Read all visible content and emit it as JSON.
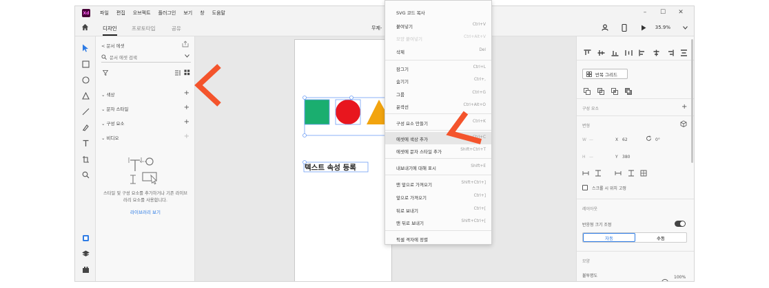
{
  "app": {
    "logo_text": "Xd",
    "menus": [
      "파일",
      "편집",
      "오브젝트",
      "플러그인",
      "보기",
      "창",
      "도움말"
    ],
    "window_controls": [
      "–",
      "☐",
      "✕"
    ]
  },
  "tabs": {
    "design": "디자인",
    "prototype": "프로토타입",
    "share": "공유"
  },
  "document": {
    "title": "무제-"
  },
  "zoom": "35.9%",
  "left_panel": {
    "back_label": "< 문서 에셋",
    "search_placeholder": "문서 에셋 검색",
    "sections": [
      {
        "label": "⌄ 색상",
        "add": "+"
      },
      {
        "label": "⌄ 문자 스타일",
        "add": "+"
      },
      {
        "label": "⌄ 구성 요소",
        "add": "+"
      },
      {
        "label": "⌄ 비디오",
        "add": "+"
      }
    ],
    "empty_text": "스타일 및 구성 요소를 추가하거나 기존 라이브러리 요소를 사용합니다.",
    "link": "라이브러리 보기"
  },
  "canvas": {
    "text_element": "텍스트 속성 등록",
    "colors": {
      "square": "#1aae6f",
      "circle": "#e8161e",
      "triangle": "#f2a40f",
      "selection": "#6e9ef5"
    }
  },
  "context_menu": {
    "items": [
      {
        "label": "SVG 코드 복사",
        "shortcut": ""
      },
      {
        "label": "붙여넣기",
        "shortcut": "Ctrl+V"
      },
      {
        "label": "모양 붙여넣기",
        "shortcut": "Ctrl+Alt+V"
      },
      {
        "label": "삭제",
        "shortcut": "Del"
      },
      {
        "label": "잠그기",
        "shortcut": "Ctrl+L"
      },
      {
        "label": "숨기기",
        "shortcut": "Ctrl+,"
      },
      {
        "label": "그룹",
        "shortcut": "Ctrl+G"
      },
      {
        "label": "윤곽선",
        "shortcut": "Ctrl+Alt+O"
      },
      {
        "label": "구성 요소 만들기",
        "shortcut": "Ctrl+K"
      },
      {
        "label": "에셋에 색상 추가",
        "shortcut": "Shift+Ctrl+C"
      },
      {
        "label": "에셋에 문자 스타일 추가",
        "shortcut": "Shift+Ctrl+T"
      },
      {
        "label": "내보내기에 대해 표시",
        "shortcut": "Shift+E"
      },
      {
        "label": "맨 앞으로 가져오기",
        "shortcut": "Shift+Ctrl+]"
      },
      {
        "label": "앞으로 가져오기",
        "shortcut": "Ctrl+]"
      },
      {
        "label": "뒤로 보내기",
        "shortcut": "Ctrl+["
      },
      {
        "label": "맨 뒤로 보내기",
        "shortcut": "Shift+Ctrl+["
      },
      {
        "label": "픽셀 격자에 정렬",
        "shortcut": ""
      }
    ]
  },
  "right_panel": {
    "repeat_grid": "반복 그리드",
    "components_label": "구성 요소",
    "components_add": "+",
    "transform_label": "변형",
    "w_label": "W",
    "h_label": "H",
    "x_label": "X",
    "x_value": "62",
    "y_label": "Y",
    "y_value": "380",
    "rotation_value": "0°",
    "fix_scroll": "스크롤 시 위치 고정",
    "layout_label": "레이아웃",
    "responsive_resize": "반응형 크기 조정",
    "auto": "자동",
    "manual": "수동",
    "appearance_label": "모양",
    "opacity_label": "불투명도",
    "opacity_value": "100%"
  },
  "annotation": {
    "arrow_color": "#f4542c"
  }
}
